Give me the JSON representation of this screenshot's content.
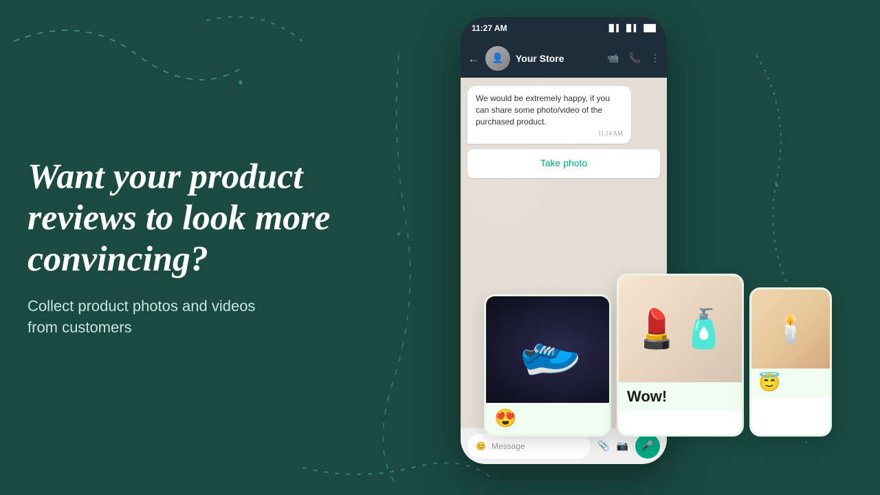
{
  "background": {
    "color": "#1a4a40"
  },
  "left": {
    "headline": "Want your product reviews to look more convincing?",
    "subtext": "Collect product photos and videos\nfrom customers"
  },
  "phone": {
    "status_bar": {
      "time": "11:27 AM",
      "signal": "📶",
      "battery": "🔋"
    },
    "header": {
      "store_name": "Your Store",
      "back_icon": "←",
      "video_icon": "📹",
      "call_icon": "📞",
      "more_icon": "⋮"
    },
    "message": {
      "text": "We would be extremely happy, if you can share some photo/video of the purchased product.",
      "time": "11.14 AM"
    },
    "take_photo_label": "Take photo",
    "input_bar": {
      "placeholder": "Message",
      "emoji_icon": "😊",
      "attach_icon": "📎",
      "camera_icon": "📷",
      "mic_icon": "🎤"
    }
  },
  "review_cards": [
    {
      "image_type": "shoe",
      "emoji": "😍",
      "text": ""
    },
    {
      "image_type": "perfume",
      "emoji": "",
      "text": "Wow!"
    },
    {
      "image_type": "candle",
      "emoji": "😇",
      "text": ""
    }
  ]
}
